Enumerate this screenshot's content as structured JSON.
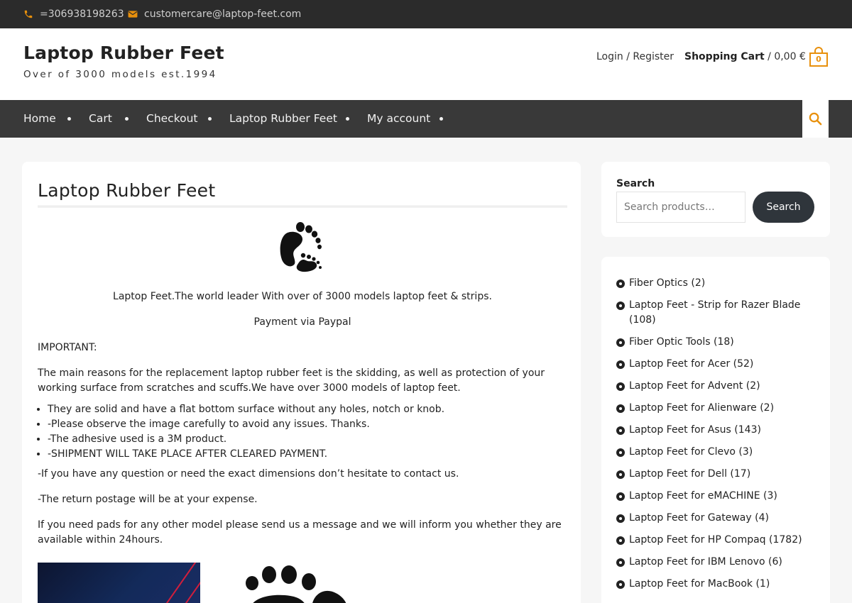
{
  "topbar": {
    "phone": "=306938198263",
    "email": "customercare@laptop-feet.com",
    "accent": "#e8900c"
  },
  "header": {
    "title": "Laptop Rubber Feet",
    "tagline": "Over of 3000 models est.1994",
    "login": "Login / Register",
    "cart_label": "Shopping Cart",
    "cart_total": " / 0,00 €",
    "cart_count": "0"
  },
  "nav": {
    "items": [
      {
        "label": "Home"
      },
      {
        "label": "Cart"
      },
      {
        "label": "Checkout"
      },
      {
        "label": "Laptop Rubber Feet"
      },
      {
        "label": "My account"
      }
    ],
    "search_icon": "search-icon"
  },
  "main": {
    "title": "Laptop Rubber Feet",
    "intro": "Laptop Feet.The world leader With over of 3000 models laptop feet & strips.",
    "payment": "Payment via Paypal",
    "important": "IMPORTANT:",
    "reasons": "The main reasons for the replacement laptop rubber feet is the  skidding, as well as protection of your working surface from scratches and scuffs.We have over 3000 models of laptop feet.",
    "bullets": [
      "They are solid and have a flat bottom surface without any holes, notch or knob.",
      "-Please observe the image carefully to avoid any issues. Thanks.",
      "-The adhesive used is a 3M product.",
      "-SHIPMENT WILL TAKE PLACE AFTER CLEARED PAYMENT."
    ],
    "question": "-If you have any question or need the exact dimensions don’t hesitate to contact us.",
    "return": "-The return postage will be at your expense.",
    "other_model": "If you need pads for any other model please send us a message and we will inform you whether they are available within 24hours."
  },
  "sidebar": {
    "search_label": "Search",
    "search_placeholder": "Search products…",
    "search_button": "Search",
    "categories": [
      "Fiber Optics (2)",
      "Laptop Feet - Strip for Razer Blade (108)",
      "Fiber Optic Tools (18)",
      "Laptop Feet for Acer (52)",
      "Laptop Feet for Advent (2)",
      "Laptop Feet for Alienware (2)",
      "Laptop Feet for Asus (143)",
      "Laptop Feet for Clevo (3)",
      "Laptop Feet for Dell (17)",
      "Laptop Feet for eMACHINE (3)",
      "Laptop Feet for Gateway (4)",
      "Laptop Feet for HP Compaq (1782)",
      "Laptop Feet for IBM Lenovo (6)",
      "Laptop Feet for MacBook (1)"
    ]
  }
}
